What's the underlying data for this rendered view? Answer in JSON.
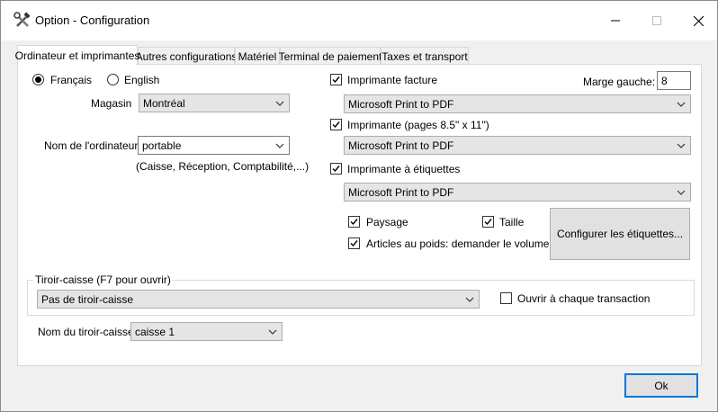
{
  "window": {
    "title": "Option - Configuration",
    "icon": "tools-icon",
    "controls": {
      "minimize": "─",
      "maximize": "☐",
      "close": "✕"
    }
  },
  "tabs": [
    {
      "label": "Ordinateur et imprimantes",
      "active": true
    },
    {
      "label": "Autres configurations",
      "active": false
    },
    {
      "label": "Matériel",
      "active": false
    },
    {
      "label": "Terminal de paiement",
      "active": false
    },
    {
      "label": "Taxes et transport",
      "active": false
    }
  ],
  "language": {
    "options": [
      {
        "label": "Français",
        "selected": true
      },
      {
        "label": "English",
        "selected": false
      }
    ]
  },
  "store": {
    "label": "Magasin",
    "value": "Montréal"
  },
  "computer": {
    "label": "Nom de l'ordinateur",
    "value": "portable",
    "hint": "(Caisse, Réception, Comptabilité,...)"
  },
  "invoice_printer": {
    "label": "Imprimante facture",
    "checked": true,
    "value": "Microsoft Print to PDF"
  },
  "left_margin": {
    "label": "Marge gauche:",
    "value": "8"
  },
  "page_printer": {
    "label": "Imprimante (pages 8.5\" x 11\")",
    "checked": true,
    "value": "Microsoft Print to PDF"
  },
  "label_printer": {
    "label": "Imprimante à étiquettes",
    "checked": true,
    "value": "Microsoft Print to PDF"
  },
  "label_options": {
    "landscape": {
      "label": "Paysage",
      "checked": true
    },
    "size": {
      "label": "Taille",
      "checked": true
    },
    "weight_items": {
      "label": "Articles au poids: demander le volume",
      "checked": true
    }
  },
  "configure_labels_button": "Configurer les étiquettes...",
  "cash_drawer": {
    "legend": "Tiroir-caisse (F7 pour ouvrir)",
    "value": "Pas de tiroir-caisse",
    "open_each_transaction": {
      "label": "Ouvrir à chaque transaction",
      "checked": false
    }
  },
  "drawer_name": {
    "label": "Nom du tiroir-caisse",
    "value": "caisse 1"
  },
  "ok_button": "Ok"
}
